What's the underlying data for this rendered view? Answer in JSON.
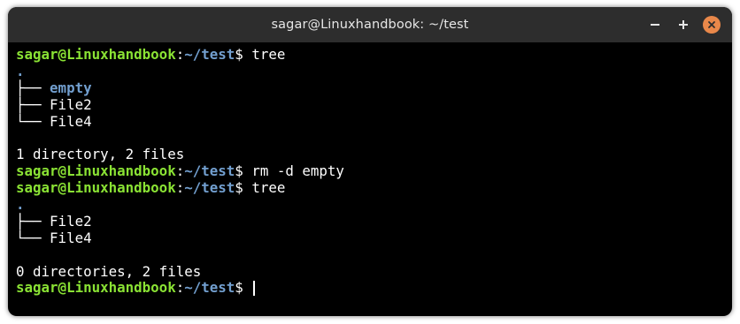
{
  "window": {
    "title": "sagar@Linuxhandbook: ~/test",
    "controls": [
      "minimize",
      "maximize",
      "close"
    ]
  },
  "prompt": {
    "user_host": "sagar@Linuxhandbook",
    "colon": ":",
    "path": "~/test",
    "symbol": "$"
  },
  "lines": [
    {
      "type": "prompt",
      "command": " tree"
    },
    {
      "type": "output",
      "text": "."
    },
    {
      "type": "tree",
      "branch": "├── ",
      "name": "empty",
      "dir": true
    },
    {
      "type": "tree",
      "branch": "├── ",
      "name": "File2",
      "dir": false
    },
    {
      "type": "tree",
      "branch": "└── ",
      "name": "File4",
      "dir": false
    },
    {
      "type": "blank",
      "text": ""
    },
    {
      "type": "output",
      "text": "1 directory, 2 files"
    },
    {
      "type": "prompt",
      "command": " rm -d empty"
    },
    {
      "type": "prompt",
      "command": " tree"
    },
    {
      "type": "output",
      "text": "."
    },
    {
      "type": "tree",
      "branch": "├── ",
      "name": "File2",
      "dir": false
    },
    {
      "type": "tree",
      "branch": "└── ",
      "name": "File4",
      "dir": false
    },
    {
      "type": "blank",
      "text": ""
    },
    {
      "type": "output",
      "text": "0 directories, 2 files"
    },
    {
      "type": "prompt",
      "command": " ",
      "cursor": true
    }
  ],
  "colors": {
    "background": "#000000",
    "titlebar": "#2d2d2d",
    "user_host": "#8ae234",
    "path": "#729fcf",
    "directory": "#729fcf",
    "text": "#ffffff",
    "close_button": "#e9884a"
  },
  "icons": {
    "minimize": "minimize-icon",
    "maximize": "maximize-icon",
    "close": "close-icon"
  }
}
